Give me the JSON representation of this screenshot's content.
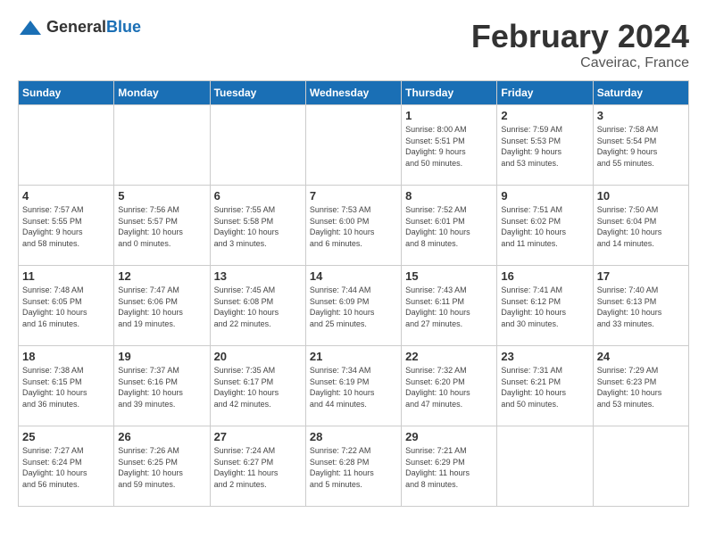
{
  "header": {
    "logo_general": "General",
    "logo_blue": "Blue",
    "month_year": "February 2024",
    "location": "Caveirac, France"
  },
  "weekdays": [
    "Sunday",
    "Monday",
    "Tuesday",
    "Wednesday",
    "Thursday",
    "Friday",
    "Saturday"
  ],
  "weeks": [
    [
      {
        "day": "",
        "info": ""
      },
      {
        "day": "",
        "info": ""
      },
      {
        "day": "",
        "info": ""
      },
      {
        "day": "",
        "info": ""
      },
      {
        "day": "1",
        "info": "Sunrise: 8:00 AM\nSunset: 5:51 PM\nDaylight: 9 hours\nand 50 minutes."
      },
      {
        "day": "2",
        "info": "Sunrise: 7:59 AM\nSunset: 5:53 PM\nDaylight: 9 hours\nand 53 minutes."
      },
      {
        "day": "3",
        "info": "Sunrise: 7:58 AM\nSunset: 5:54 PM\nDaylight: 9 hours\nand 55 minutes."
      }
    ],
    [
      {
        "day": "4",
        "info": "Sunrise: 7:57 AM\nSunset: 5:55 PM\nDaylight: 9 hours\nand 58 minutes."
      },
      {
        "day": "5",
        "info": "Sunrise: 7:56 AM\nSunset: 5:57 PM\nDaylight: 10 hours\nand 0 minutes."
      },
      {
        "day": "6",
        "info": "Sunrise: 7:55 AM\nSunset: 5:58 PM\nDaylight: 10 hours\nand 3 minutes."
      },
      {
        "day": "7",
        "info": "Sunrise: 7:53 AM\nSunset: 6:00 PM\nDaylight: 10 hours\nand 6 minutes."
      },
      {
        "day": "8",
        "info": "Sunrise: 7:52 AM\nSunset: 6:01 PM\nDaylight: 10 hours\nand 8 minutes."
      },
      {
        "day": "9",
        "info": "Sunrise: 7:51 AM\nSunset: 6:02 PM\nDaylight: 10 hours\nand 11 minutes."
      },
      {
        "day": "10",
        "info": "Sunrise: 7:50 AM\nSunset: 6:04 PM\nDaylight: 10 hours\nand 14 minutes."
      }
    ],
    [
      {
        "day": "11",
        "info": "Sunrise: 7:48 AM\nSunset: 6:05 PM\nDaylight: 10 hours\nand 16 minutes."
      },
      {
        "day": "12",
        "info": "Sunrise: 7:47 AM\nSunset: 6:06 PM\nDaylight: 10 hours\nand 19 minutes."
      },
      {
        "day": "13",
        "info": "Sunrise: 7:45 AM\nSunset: 6:08 PM\nDaylight: 10 hours\nand 22 minutes."
      },
      {
        "day": "14",
        "info": "Sunrise: 7:44 AM\nSunset: 6:09 PM\nDaylight: 10 hours\nand 25 minutes."
      },
      {
        "day": "15",
        "info": "Sunrise: 7:43 AM\nSunset: 6:11 PM\nDaylight: 10 hours\nand 27 minutes."
      },
      {
        "day": "16",
        "info": "Sunrise: 7:41 AM\nSunset: 6:12 PM\nDaylight: 10 hours\nand 30 minutes."
      },
      {
        "day": "17",
        "info": "Sunrise: 7:40 AM\nSunset: 6:13 PM\nDaylight: 10 hours\nand 33 minutes."
      }
    ],
    [
      {
        "day": "18",
        "info": "Sunrise: 7:38 AM\nSunset: 6:15 PM\nDaylight: 10 hours\nand 36 minutes."
      },
      {
        "day": "19",
        "info": "Sunrise: 7:37 AM\nSunset: 6:16 PM\nDaylight: 10 hours\nand 39 minutes."
      },
      {
        "day": "20",
        "info": "Sunrise: 7:35 AM\nSunset: 6:17 PM\nDaylight: 10 hours\nand 42 minutes."
      },
      {
        "day": "21",
        "info": "Sunrise: 7:34 AM\nSunset: 6:19 PM\nDaylight: 10 hours\nand 44 minutes."
      },
      {
        "day": "22",
        "info": "Sunrise: 7:32 AM\nSunset: 6:20 PM\nDaylight: 10 hours\nand 47 minutes."
      },
      {
        "day": "23",
        "info": "Sunrise: 7:31 AM\nSunset: 6:21 PM\nDaylight: 10 hours\nand 50 minutes."
      },
      {
        "day": "24",
        "info": "Sunrise: 7:29 AM\nSunset: 6:23 PM\nDaylight: 10 hours\nand 53 minutes."
      }
    ],
    [
      {
        "day": "25",
        "info": "Sunrise: 7:27 AM\nSunset: 6:24 PM\nDaylight: 10 hours\nand 56 minutes."
      },
      {
        "day": "26",
        "info": "Sunrise: 7:26 AM\nSunset: 6:25 PM\nDaylight: 10 hours\nand 59 minutes."
      },
      {
        "day": "27",
        "info": "Sunrise: 7:24 AM\nSunset: 6:27 PM\nDaylight: 11 hours\nand 2 minutes."
      },
      {
        "day": "28",
        "info": "Sunrise: 7:22 AM\nSunset: 6:28 PM\nDaylight: 11 hours\nand 5 minutes."
      },
      {
        "day": "29",
        "info": "Sunrise: 7:21 AM\nSunset: 6:29 PM\nDaylight: 11 hours\nand 8 minutes."
      },
      {
        "day": "",
        "info": ""
      },
      {
        "day": "",
        "info": ""
      }
    ]
  ]
}
